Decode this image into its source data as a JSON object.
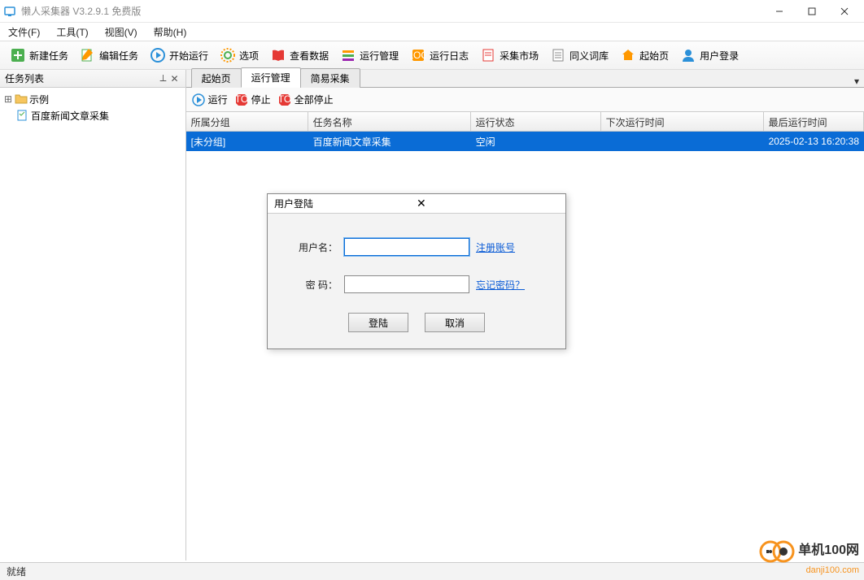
{
  "window": {
    "title": "懒人采集器 V3.2.9.1 免费版"
  },
  "menu": {
    "file": "文件(F)",
    "tool": "工具(T)",
    "view": "视图(V)",
    "help": "帮助(H)"
  },
  "toolbar": {
    "new_task": "新建任务",
    "edit_task": "编辑任务",
    "start_run": "开始运行",
    "options": "选项",
    "view_data": "查看数据",
    "run_manage": "运行管理",
    "run_log": "运行日志",
    "market": "采集市场",
    "synonym": "同义词库",
    "start_page": "起始页",
    "user_login": "用户登录"
  },
  "sidebar": {
    "title": "任务列表",
    "group": "示例",
    "task": "百度新闻文章采集"
  },
  "tabs": {
    "t1": "起始页",
    "t2": "运行管理",
    "t3": "简易采集"
  },
  "subbar": {
    "run": "运行",
    "stop": "停止",
    "stop_all": "全部停止"
  },
  "grid": {
    "h1": "所属分组",
    "h2": "任务名称",
    "h3": "运行状态",
    "h4": "下次运行时间",
    "h5": "最后运行时间",
    "r1c1": "[未分组]",
    "r1c2": "百度新闻文章采集",
    "r1c3": "空闲",
    "r1c4": "",
    "r1c5": "2025-02-13 16:20:38"
  },
  "dialog": {
    "title": "用户登陆",
    "user_lbl": "用户名：",
    "pwd_lbl": "密  码：",
    "register": "注册账号",
    "forgot": "忘记密码？",
    "login": "登陆",
    "cancel": "取消"
  },
  "status": {
    "ready": "就绪"
  },
  "watermark": {
    "line1": "单机100网",
    "line2": "danji100.com"
  }
}
